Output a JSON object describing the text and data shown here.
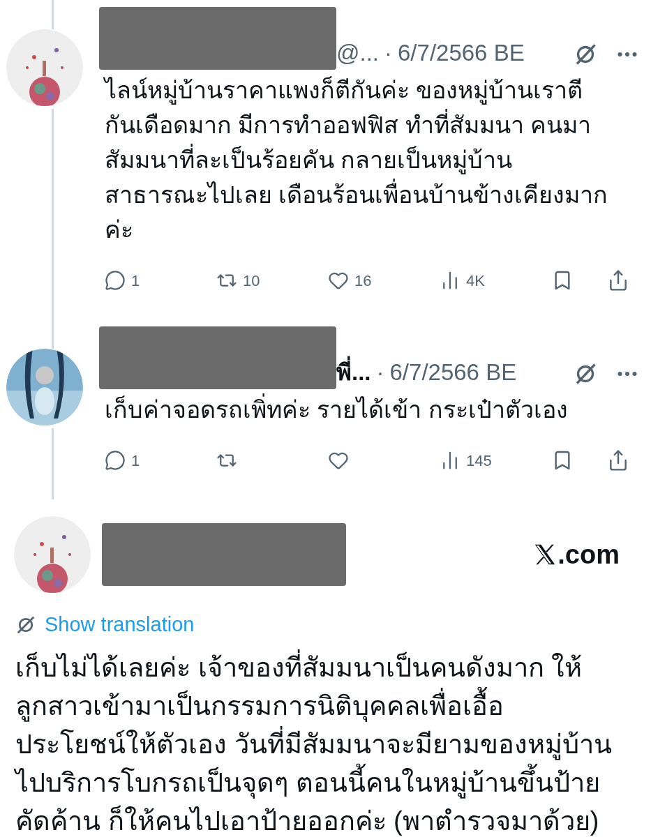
{
  "tweets": [
    {
      "handle": "@...",
      "separator": "·",
      "date": "6/7/2566 BE",
      "text_lines": [
        "ไลน์หมู่บ้านราคาแพงก็ตีกันค่ะ ของหมู่บ้านเราตี",
        "กันเดือดมาก มีการทำออฟฟิส ทำที่สัมมนา คนมา",
        "สัมมนาที่ละเป็นร้อยคัน กลายเป็นหมู่บ้าน",
        "สาธารณะไปเลย เดือนร้อนเพื่อนบ้านข้างเคียงมาก",
        "ค่ะ"
      ],
      "handle_bold": false,
      "replies": "1",
      "reposts": "10",
      "likes": "16",
      "views": "4K"
    },
    {
      "handle": "พี่...",
      "separator": "·",
      "date": "6/7/2566 BE",
      "text_lines": [
        "เก็บค่าจอดรถเพิ่ทค่ะ รายได้เข้า กระเป๋าตัวเอง"
      ],
      "handle_bold": true,
      "replies": "1",
      "views": "145"
    }
  ],
  "main": {
    "brand": ".com",
    "translate_link": "Show translation",
    "text_lines": [
      "เก็บไม่ได้เลยค่ะ เจ้าของที่สัมมนาเป็นคนดังมาก ให้",
      "ลูกสาวเข้ามาเป็นกรรมการนิติบุคคลเพื่อเอื้อ",
      "ประโยชน์ให้ตัวเอง วันที่มีสัมมนาจะมียามของหมู่บ้าน",
      "ไปบริการโบกรถเป็นจุดๆ ตอนนี้คนในหมู่บ้านขึ้นป้าย",
      "คัดค้าน ก็ให้คนไปเอาป้ายออกค่ะ (พาตำรวจมาด้วย)"
    ]
  }
}
